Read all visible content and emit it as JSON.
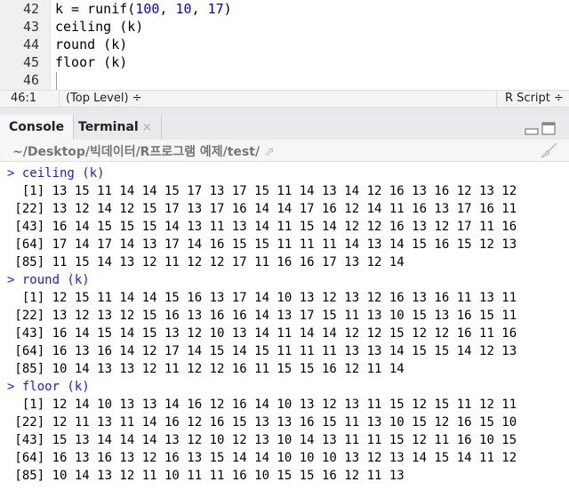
{
  "editor": {
    "lines": [
      {
        "number": "42",
        "code": "k = runif(100, 10, 17)"
      },
      {
        "number": "43",
        "code": "ceiling (k)"
      },
      {
        "number": "44",
        "code": "round (k)"
      },
      {
        "number": "45",
        "code": "floor (k)"
      },
      {
        "number": "46",
        "code": ""
      }
    ]
  },
  "status_bar": {
    "position": "46:1",
    "scope": "(Top Level) ÷",
    "file_type": "R Script ÷"
  },
  "tabs": [
    {
      "label": "Console"
    },
    {
      "label": "Terminal",
      "close": "×"
    }
  ],
  "path": "~/Desktop/빅데이터/R프로그램 예제/test/",
  "console": [
    {
      "command": "> ceiling (k)",
      "rows": [
        "  [1] 13 15 11 14 14 15 17 13 17 15 11 14 13 14 12 16 13 16 12 13 12",
        " [22] 13 12 14 12 15 17 13 17 16 14 14 17 16 12 14 11 16 13 17 16 11",
        " [43] 16 14 15 15 15 14 13 11 13 14 11 15 14 12 12 16 13 12 17 11 16",
        " [64] 17 14 17 14 13 17 14 16 15 15 11 11 11 14 13 14 15 16 15 12 13",
        " [85] 11 15 14 13 12 11 12 12 17 11 16 16 17 13 12 14"
      ]
    },
    {
      "command": "> round (k)",
      "rows": [
        "  [1] 12 15 11 14 14 15 16 13 17 14 10 13 12 13 12 16 13 16 11 13 11",
        " [22] 13 12 13 12 15 16 13 16 16 14 13 17 15 11 13 10 15 13 16 15 11",
        " [43] 16 14 15 14 15 13 12 10 13 14 11 14 14 12 12 15 12 12 16 11 16",
        " [64] 16 13 16 14 12 17 14 15 14 15 11 11 11 13 13 14 15 15 14 12 13",
        " [85] 10 14 13 13 12 11 12 12 16 11 15 15 16 12 11 14"
      ]
    },
    {
      "command": "> floor (k)",
      "rows": [
        "  [1] 12 14 10 13 13 14 16 12 16 14 10 13 12 13 11 15 12 15 11 12 11",
        " [22] 12 11 13 11 14 16 12 16 15 13 13 16 15 11 13 10 15 12 16 15 10",
        " [43] 15 13 14 14 14 13 12 10 12 13 10 14 13 11 11 15 12 11 16 10 15",
        " [64] 16 13 16 13 12 16 13 15 14 14 10 10 10 13 12 13 14 15 14 11 12",
        " [85] 10 14 13 12 11 10 11 11 16 10 15 15 16 12 11 13"
      ]
    }
  ],
  "colors": {
    "command": "#1a1aee",
    "number_literal": "#0000dd"
  },
  "icons": [
    "follow-link-icon",
    "minimize-icon",
    "maximize-icon",
    "broom-icon"
  ]
}
